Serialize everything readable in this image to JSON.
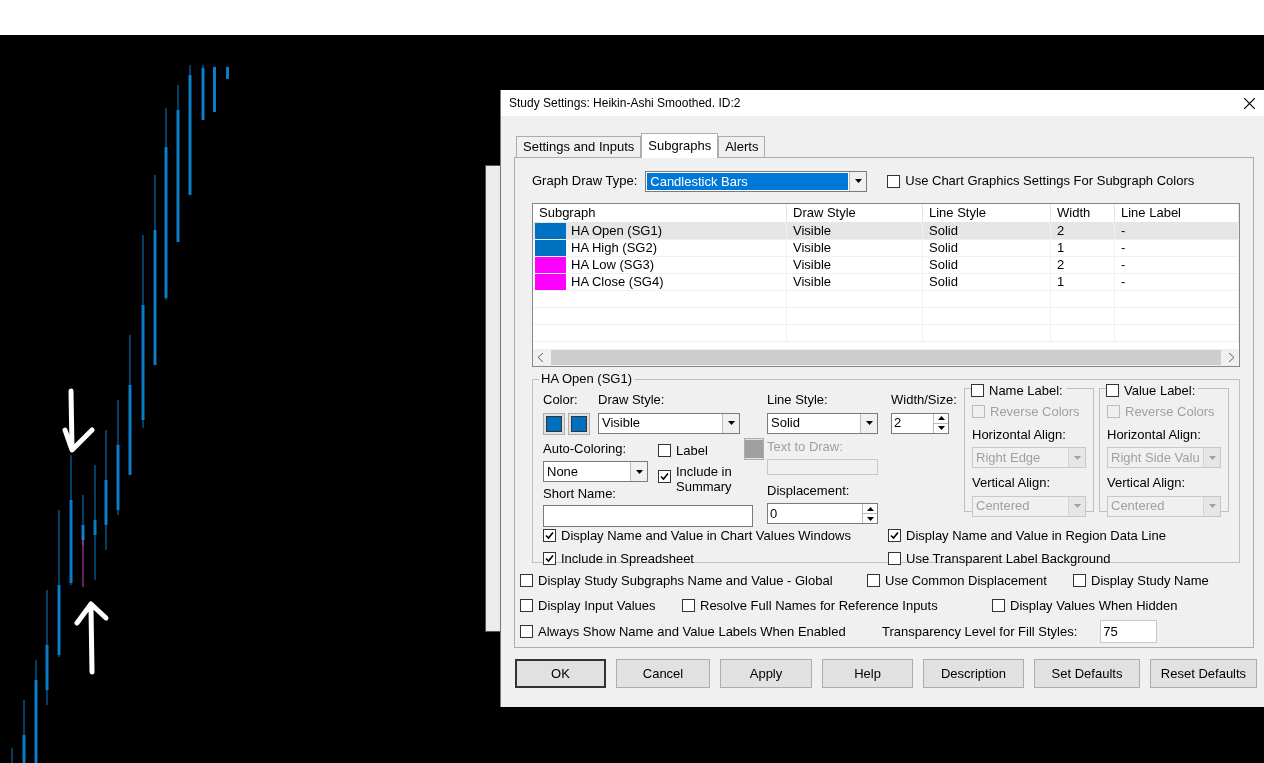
{
  "window": {
    "title": "Study Settings: Heikin-Ashi Smoothed. ID:2"
  },
  "tabs": [
    {
      "label": "Settings and Inputs",
      "selected": false
    },
    {
      "label": "Subgraphs",
      "selected": true
    },
    {
      "label": "Alerts",
      "selected": false
    }
  ],
  "graph_draw_type": {
    "label": "Graph Draw Type:",
    "value": "Candlestick Bars"
  },
  "use_chart_graphics": {
    "label": "Use Chart Graphics Settings For Subgraph Colors",
    "checked": false
  },
  "table": {
    "columns": [
      "Subgraph",
      "Draw Style",
      "Line Style",
      "Width",
      "Line Label"
    ],
    "rows": [
      {
        "color": "#0070c0",
        "cells": [
          "HA Open (SG1)",
          "Visible",
          "Solid",
          "2",
          "-"
        ],
        "selected": true
      },
      {
        "color": "#0070c0",
        "cells": [
          "HA High (SG2)",
          "Visible",
          "Solid",
          "1",
          "-"
        ],
        "selected": false
      },
      {
        "color": "#ff00ff",
        "cells": [
          "HA Low (SG3)",
          "Visible",
          "Solid",
          "2",
          "-"
        ],
        "selected": false
      },
      {
        "color": "#ff00ff",
        "cells": [
          "HA Close (SG4)",
          "Visible",
          "Solid",
          "1",
          "-"
        ],
        "selected": false
      }
    ]
  },
  "subgraph": {
    "title": "HA Open (SG1)",
    "color": {
      "label": "Color:",
      "swatches": [
        {
          "color": "#0070c0"
        },
        {
          "color": "#0070c0"
        }
      ]
    },
    "draw_style": {
      "label": "Draw Style:",
      "value": "Visible"
    },
    "line_style": {
      "label": "Line Style:",
      "value": "Solid"
    },
    "width": {
      "label": "Width/Size:",
      "value": "2"
    },
    "auto_coloring": {
      "label": "Auto-Coloring:",
      "value": "None"
    },
    "label": {
      "label": "Label",
      "checked": false
    },
    "include_in_summary": {
      "label": "Include in Summary",
      "checked": true
    },
    "text_to_draw": {
      "label": "Text to Draw:",
      "disabled": true
    },
    "short_name": {
      "label": "Short Name:"
    },
    "displacement": {
      "label": "Displacement:",
      "value": "0"
    },
    "label_groups": [
      {
        "label": "Name Label:",
        "checked": false,
        "reverse_colors": {
          "label": "Reverse Colors",
          "checked": false
        },
        "horizontal_align": {
          "label": "Horizontal Align:",
          "value": "Right Edge"
        },
        "vertical_align": {
          "label": "Vertical Align:",
          "value": "Centered"
        },
        "disabled": true
      },
      {
        "label": "Value Label:",
        "checked": false,
        "reverse_colors": {
          "label": "Reverse Colors",
          "checked": false
        },
        "horizontal_align": {
          "label": "Horizontal Align:",
          "value": "Right Side Valu"
        },
        "vertical_align": {
          "label": "Vertical Align:",
          "value": "Centered"
        },
        "disabled": true
      }
    ],
    "options": [
      {
        "label": "Display Name and Value in Chart Values Windows",
        "checked": true
      },
      {
        "label": "Display Name and Value in Region Data Line",
        "checked": true
      },
      {
        "label": "Include in Spreadsheet",
        "checked": true
      },
      {
        "label": "Use Transparent Label Background",
        "checked": false
      }
    ]
  },
  "global_options": [
    [
      {
        "kind": "checkbox",
        "label": "Display Study Subgraphs Name and Value - Global",
        "checked": false
      },
      {
        "kind": "checkbox",
        "label": "Use Common Displacement",
        "checked": false
      },
      {
        "kind": "checkbox",
        "label": "Display Study Name",
        "checked": false
      }
    ],
    [
      {
        "kind": "checkbox",
        "label": "Display Input Values",
        "checked": false
      },
      {
        "kind": "checkbox",
        "label": "Resolve Full Names for Reference Inputs",
        "checked": false
      },
      {
        "kind": "checkbox",
        "label": "Display Values When Hidden",
        "checked": false
      }
    ],
    [
      {
        "kind": "checkbox",
        "label": "Always Show Name and Value Labels When Enabled",
        "checked": false
      },
      {
        "kind": "field",
        "label": "Transparency Level for Fill Styles:",
        "value": "75"
      }
    ]
  ],
  "buttons": [
    {
      "label": "OK",
      "default": true
    },
    {
      "label": "Cancel",
      "default": false
    },
    {
      "label": "Apply",
      "default": false
    },
    {
      "label": "Help",
      "default": false
    },
    {
      "label": "Description",
      "default": false
    },
    {
      "label": "Set Defaults",
      "default": false
    },
    {
      "label": "Reset Defaults",
      "default": false
    }
  ]
}
